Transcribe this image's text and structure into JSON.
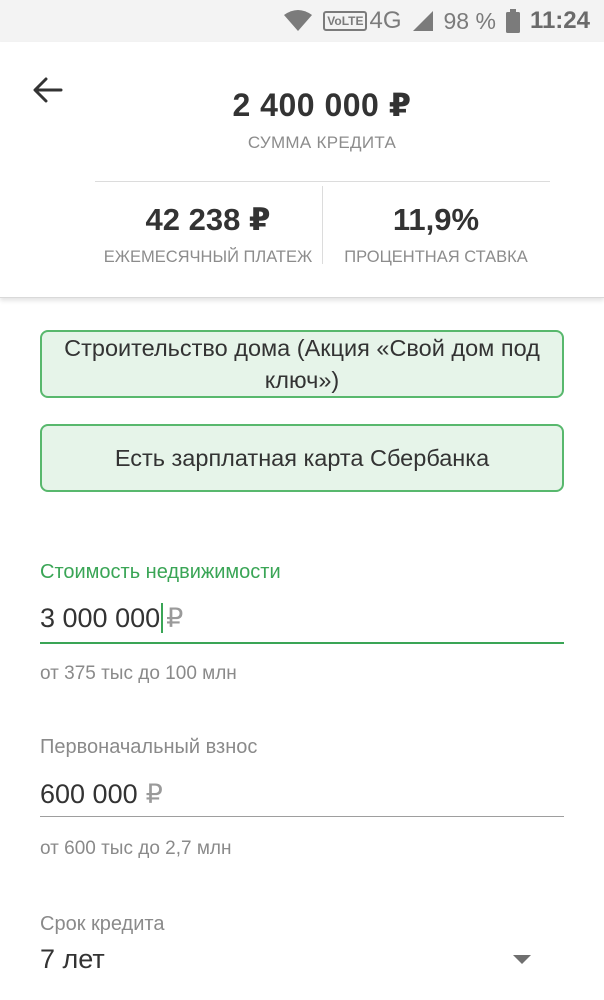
{
  "status_bar": {
    "network": "VoLTE",
    "network_type": "4G",
    "battery": "98 %",
    "time": "11:24"
  },
  "summary": {
    "loan_amount": "2 400 000 ₽",
    "loan_amount_label": "СУММА КРЕДИТА",
    "monthly_payment": "42 238 ₽",
    "monthly_payment_label": "ЕЖЕМЕСЯЧНЫЙ ПЛАТЕЖ",
    "interest_rate": "11,9%",
    "interest_rate_label": "ПРОЦЕНТНАЯ СТАВКА"
  },
  "options": [
    {
      "label": "Строительство дома (Акция «Свой дом под ключ»)"
    },
    {
      "label": "Есть зарплатная карта Сбербанка"
    }
  ],
  "fields": {
    "property_cost": {
      "label": "Стоимость недвижимости",
      "value": "3 000 000",
      "currency": "₽",
      "hint": "от 375 тыс до 100 млн"
    },
    "down_payment": {
      "label": "Первоначальный взнос",
      "value": "600 000",
      "currency": "₽",
      "hint": "от 600 тыс до 2,7 млн"
    },
    "loan_term": {
      "label": "Срок кредита",
      "value": "7 лет"
    }
  },
  "colors": {
    "accent": "#3aa556",
    "chip_bg": "#e6f4e9",
    "chip_border": "#58b86d"
  },
  "icons": [
    "wifi-icon",
    "signal-icon",
    "battery-icon",
    "back-arrow-icon",
    "dropdown-arrow-icon"
  ]
}
